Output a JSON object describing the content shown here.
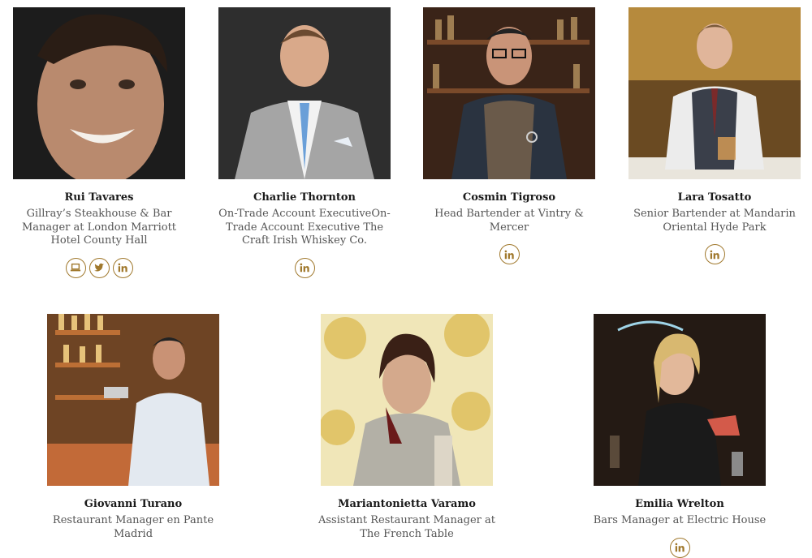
{
  "team": {
    "accent_color": "#a0782c",
    "members": [
      {
        "name": "Rui Tavares",
        "role": "Gillray’s Steakhouse & Bar Manager at London Marriott Hotel County Hall",
        "socials": [
          "laptop-icon",
          "twitter-icon",
          "linkedin-icon"
        ]
      },
      {
        "name": "Charlie Thornton",
        "role": "On-Trade Account ExecutiveOn-Trade Account Executive The Craft Irish Whiskey Co.",
        "socials": [
          "linkedin-icon"
        ]
      },
      {
        "name": "Cosmin Tigroso",
        "role": "Head Bartender at Vintry & Mercer",
        "socials": [
          "linkedin-icon"
        ]
      },
      {
        "name": "Lara Tosatto",
        "role": "Senior Bartender at Mandarin Oriental Hyde Park",
        "socials": [
          "linkedin-icon"
        ]
      },
      {
        "name": "Giovanni Turano",
        "role": "Restaurant Manager en Pante Madrid",
        "socials": []
      },
      {
        "name": "Mariantonietta Varamo",
        "role": "Assistant Restaurant Manager at The French Table",
        "socials": []
      },
      {
        "name": "Emilia Wrelton",
        "role": "Bars Manager at Electric House",
        "socials": [
          "linkedin-icon"
        ]
      }
    ]
  }
}
